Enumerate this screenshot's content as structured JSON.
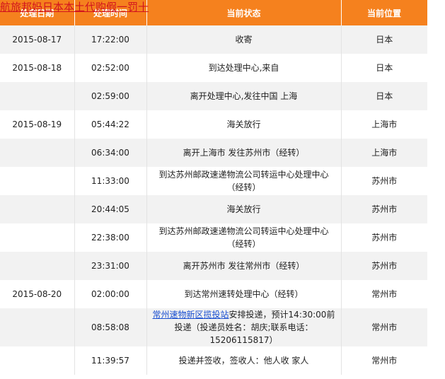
{
  "banner_link": "航旅邦妈日本本土代购假一罚十",
  "header": {
    "date": "处理日期",
    "time": "处理时间",
    "status": "当前状态",
    "location": "当前位置"
  },
  "rows": [
    {
      "date": "2015-08-17",
      "time": "17:22:00",
      "status": "收寄",
      "location": "日本"
    },
    {
      "date": "2015-08-18",
      "time": "02:52:00",
      "status": "到达处理中心,来自",
      "location": "日本"
    },
    {
      "date": "",
      "time": "02:59:00",
      "status": "离开处理中心,发往中国 上海",
      "location": "日本"
    },
    {
      "date": "2015-08-19",
      "time": "05:44:22",
      "status": "海关放行",
      "location": "上海市"
    },
    {
      "date": "",
      "time": "06:34:00",
      "status": "离开上海市 发往苏州市（经转）",
      "location": "上海市"
    },
    {
      "date": "",
      "time": "11:33:00",
      "status": "到达苏州邮政速递物流公司转运中心处理中心（经转）",
      "location": "苏州市"
    },
    {
      "date": "",
      "time": "20:44:05",
      "status": "海关放行",
      "location": "苏州市"
    },
    {
      "date": "",
      "time": "22:38:00",
      "status": "到达苏州邮政速递物流公司转运中心处理中心（经转）",
      "location": "苏州市"
    },
    {
      "date": "",
      "time": "23:31:00",
      "status": "离开苏州市 发往常州市（经转）",
      "location": "苏州市"
    },
    {
      "date": "2015-08-20",
      "time": "02:00:00",
      "status": "到达常州速转处理中心（经转）",
      "location": "常州市"
    },
    {
      "date": "",
      "time": "08:58:08",
      "status_link": "常州速物新区揽投站",
      "status": "安排投递，预计14:30:00前投递（投递员姓名：胡庆;联系电话：15206115817）",
      "location": "常州市"
    },
    {
      "date": "",
      "time": "11:39:57",
      "status": "投递并签收，签收人：他人收 家人",
      "location": "常州市"
    }
  ]
}
